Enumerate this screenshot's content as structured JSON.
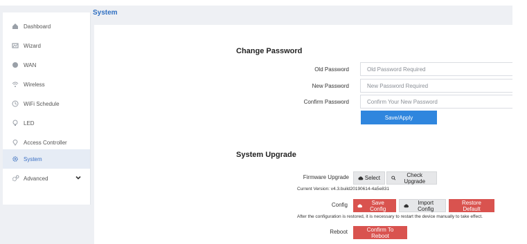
{
  "colors": {
    "accent": "#2f86de",
    "danger": "#d9534f",
    "title": "#2f6fc1",
    "sidebar_active_bg": "#e6ecf5"
  },
  "sidebar": {
    "items": [
      {
        "label": "Dashboard",
        "icon": "dashboard-icon"
      },
      {
        "label": "Wizard",
        "icon": "wizard-icon"
      },
      {
        "label": "WAN",
        "icon": "wan-icon"
      },
      {
        "label": "Wireless",
        "icon": "wireless-icon"
      },
      {
        "label": "WiFi Schedule",
        "icon": "clock-icon"
      },
      {
        "label": "LED",
        "icon": "bulb-icon"
      },
      {
        "label": "Access Controller",
        "icon": "location-icon"
      },
      {
        "label": "System",
        "icon": "gear-icon",
        "active": true
      },
      {
        "label": "Advanced",
        "icon": "gears-icon",
        "expandable": true
      }
    ]
  },
  "page": {
    "title": "System"
  },
  "change_password": {
    "title": "Change Password",
    "old_label": "Old Password",
    "old_placeholder": "Old Password Required",
    "new_label": "New Password",
    "new_placeholder": "New Password Required",
    "confirm_label": "Confirm Password",
    "confirm_placeholder": "Confirm Your New Password",
    "save_label": "Save/Apply"
  },
  "system_upgrade": {
    "title": "System Upgrade",
    "firmware_label": "Firmware Upgrade",
    "select_label": "Select",
    "check_label": "Check Upgrade",
    "current_version": "Current Version: v4.3.build20190614-4a5e831",
    "config_label": "Config",
    "save_config_label": "Save Config",
    "import_config_label": "Import Config",
    "restore_label": "Restore Default",
    "restore_note": "After the configuration is restored, it is necessary to restart the device manually to take effect.",
    "reboot_label": "Reboot",
    "confirm_reboot_label": "Confirm To Reboot"
  }
}
